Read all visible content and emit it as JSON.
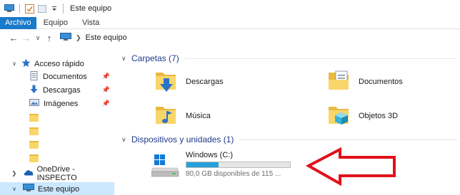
{
  "titlebar": {
    "title": "Este equipo"
  },
  "ribbon": {
    "tabs": [
      "Archivo",
      "Equipo",
      "Vista"
    ]
  },
  "address": {
    "path": "Este equipo"
  },
  "nav": {
    "quick_access": "Acceso rápido",
    "items": [
      {
        "label": "Documentos"
      },
      {
        "label": "Descargas"
      },
      {
        "label": "Imágenes"
      }
    ],
    "onedrive": "OneDrive - INSPECTO",
    "this_pc": "Este equipo"
  },
  "content": {
    "folders_header": "Carpetas (7)",
    "folders": [
      {
        "label": "Descargas"
      },
      {
        "label": "Documentos"
      },
      {
        "label": "Música"
      },
      {
        "label": "Objetos 3D"
      }
    ],
    "devices_header": "Dispositivos y unidades (1)",
    "drive": {
      "name": "Windows (C:)",
      "free_text": "80,0 GB disponibles de 115 ...",
      "used_fraction": 0.31
    }
  },
  "colors": {
    "accent": "#1979ca",
    "selection": "#cce8ff",
    "drive_bar": "#26a0da",
    "arrow": "#e0121b"
  }
}
